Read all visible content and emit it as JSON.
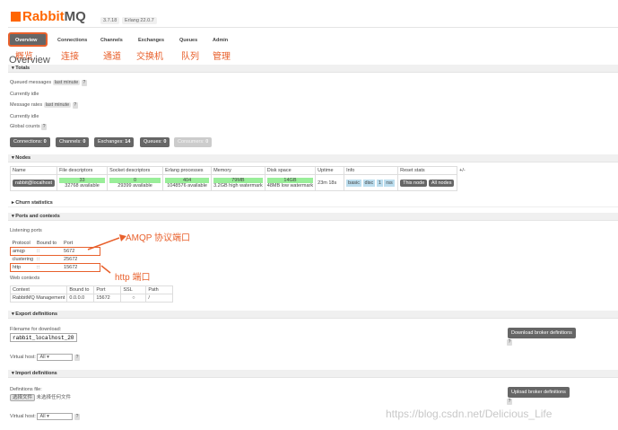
{
  "header": {
    "logo_prefix": "Rabbit",
    "logo_suffix": "MQ",
    "version": "3.7.18",
    "erlang": "Erlang 22.0.7"
  },
  "tabs": [
    {
      "label": "Overview",
      "cn": "概览"
    },
    {
      "label": "Connections",
      "cn": "连接"
    },
    {
      "label": "Channels",
      "cn": "通道"
    },
    {
      "label": "Exchanges",
      "cn": "交换机"
    },
    {
      "label": "Queues",
      "cn": "队列"
    },
    {
      "label": "Admin",
      "cn": "管理"
    }
  ],
  "page_title": "Overview",
  "totals": {
    "title": "Totals",
    "queued_messages": "Queued messages",
    "last_minute": "last minute",
    "currently_idle": "Currently idle",
    "message_rates": "Message rates",
    "currently_idle2": "Currently idle",
    "global_counts": "Global counts",
    "q": "?",
    "counts": [
      {
        "label": "Connections:",
        "value": "0"
      },
      {
        "label": "Channels:",
        "value": "0"
      },
      {
        "label": "Exchanges:",
        "value": "14"
      },
      {
        "label": "Queues:",
        "value": "0"
      },
      {
        "label": "Consumers:",
        "value": "0"
      }
    ]
  },
  "nodes": {
    "title": "Nodes",
    "headers": [
      "Name",
      "File descriptors",
      "Socket descriptors",
      "Erlang processes",
      "Memory",
      "Disk space",
      "Uptime",
      "Info",
      "Reset stats",
      "+/-"
    ],
    "name": "rabbit@localhost",
    "fd": "33",
    "fd_sub": "32768 available",
    "sd": "0",
    "sd_sub": "29399 available",
    "ep": "404",
    "ep_sub": "1048576 available",
    "mem": "79MB",
    "mem_sub": "3.2GB high watermark",
    "disk": "14GB",
    "disk_sub": "48MB low watermark",
    "uptime": "23m 18s",
    "info": [
      "basic",
      "disc",
      "1",
      "rss"
    ],
    "reset_this": "This node",
    "reset_all": "All nodes"
  },
  "churn": {
    "title": "Churn statistics"
  },
  "ports": {
    "title": "Ports and contexts",
    "listening": "Listening ports",
    "headers": [
      "Protocol",
      "Bound to",
      "Port"
    ],
    "rows": [
      {
        "protocol": "amqp",
        "bound": "::",
        "port": "5672"
      },
      {
        "protocol": "clustering",
        "bound": "::",
        "port": "25672"
      },
      {
        "protocol": "http",
        "bound": "::",
        "port": "15672"
      }
    ],
    "web_contexts": "Web contexts",
    "ctx_headers": [
      "Context",
      "Bound to",
      "Port",
      "SSL",
      "Path"
    ],
    "ctx_row": {
      "context": "RabbitMQ Management",
      "bound": "0.0.0.0",
      "port": "15672",
      "ssl": "○",
      "path": "/"
    },
    "amqp_note": "AMQP 协议端口",
    "http_note": "http 端口"
  },
  "export": {
    "title": "Export definitions",
    "filename_label": "Filename for download:",
    "filename_value": "rabbit_localhost_2019",
    "vhost_label": "Virtual host:",
    "vhost_value": "All",
    "button": "Download broker definitions",
    "q": "?"
  },
  "import": {
    "title": "Import definitions",
    "file_label": "Definitions file:",
    "choose": "选择文件",
    "nofile": "未选择任何文件",
    "vhost_label": "Virtual host:",
    "vhost_value": "All",
    "button": "Upload broker definitions",
    "q": "?"
  },
  "watermark": "https://blog.csdn.net/Delicious_Life"
}
